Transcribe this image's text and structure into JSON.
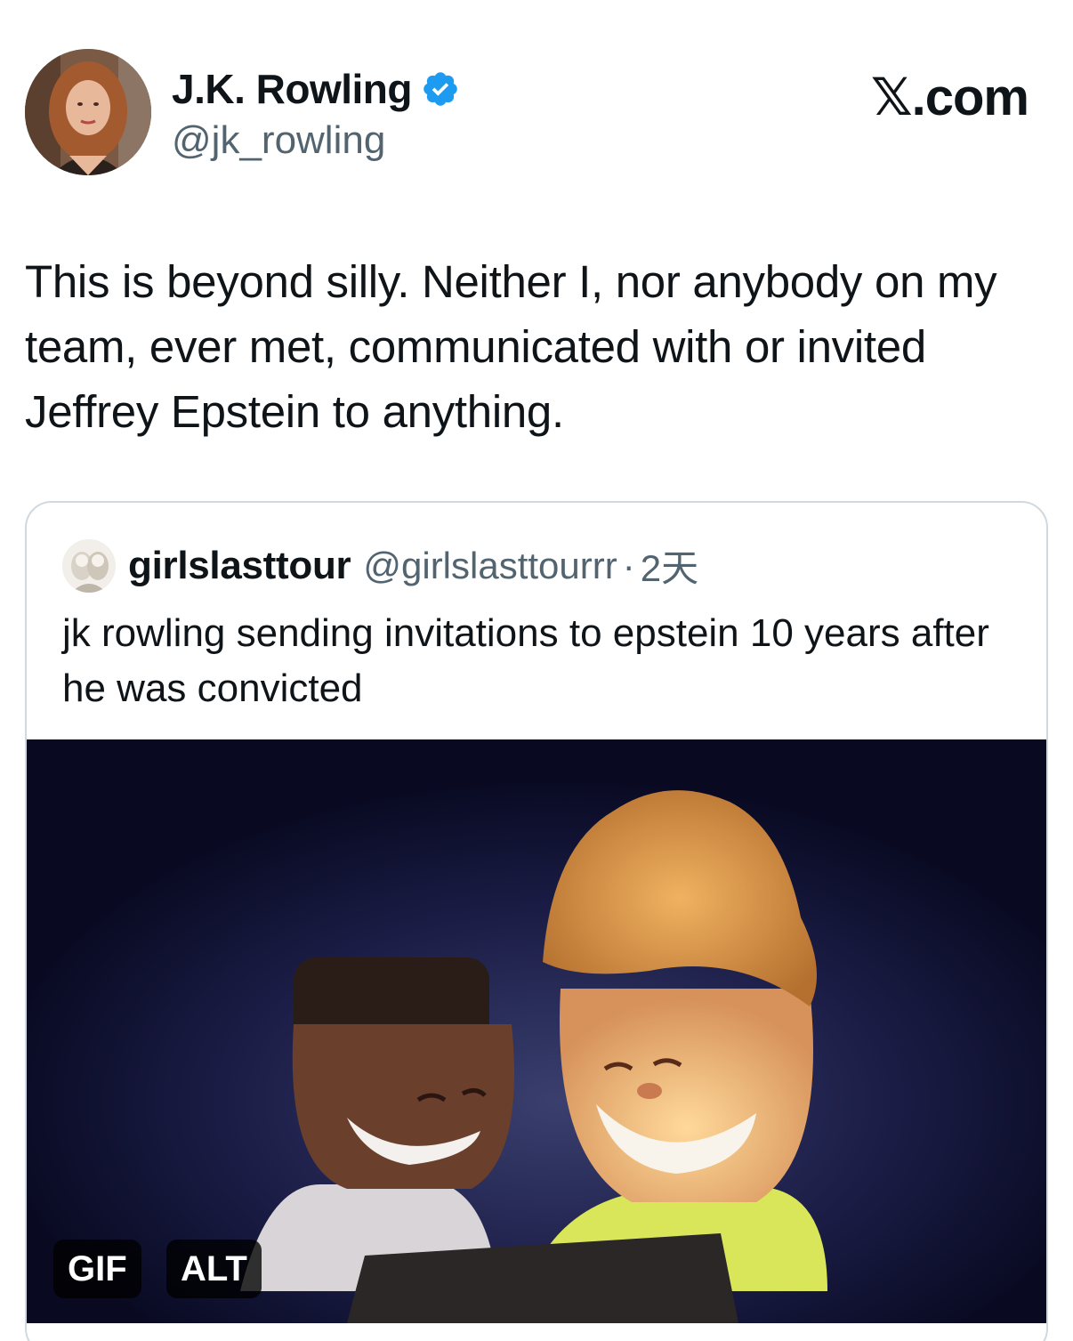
{
  "author": {
    "name": "J.K. Rowling",
    "handle": "@jk_rowling",
    "verified": true,
    "avatar": "author-photo"
  },
  "site": {
    "logo_text": "𝕏.com"
  },
  "tweet": {
    "text": "This is beyond silly. Neither I, nor anybody on my team, ever met, communicated with or invited Jeffrey Epstein to anything."
  },
  "quoted": {
    "name": "girlslasttour",
    "handle": "@girlslasttourrr",
    "separator": "·",
    "time": "2天",
    "text": "jk rowling sending invitations to epstein 10 years after he was convicted",
    "media": {
      "type": "gif",
      "description_icon": "cartoon-gif",
      "gif_badge": "GIF",
      "alt_badge": "ALT"
    }
  },
  "colors": {
    "text_primary": "#0f1419",
    "text_secondary": "#536471",
    "verified_blue": "#1d9bf0",
    "border": "#cfd9de"
  }
}
